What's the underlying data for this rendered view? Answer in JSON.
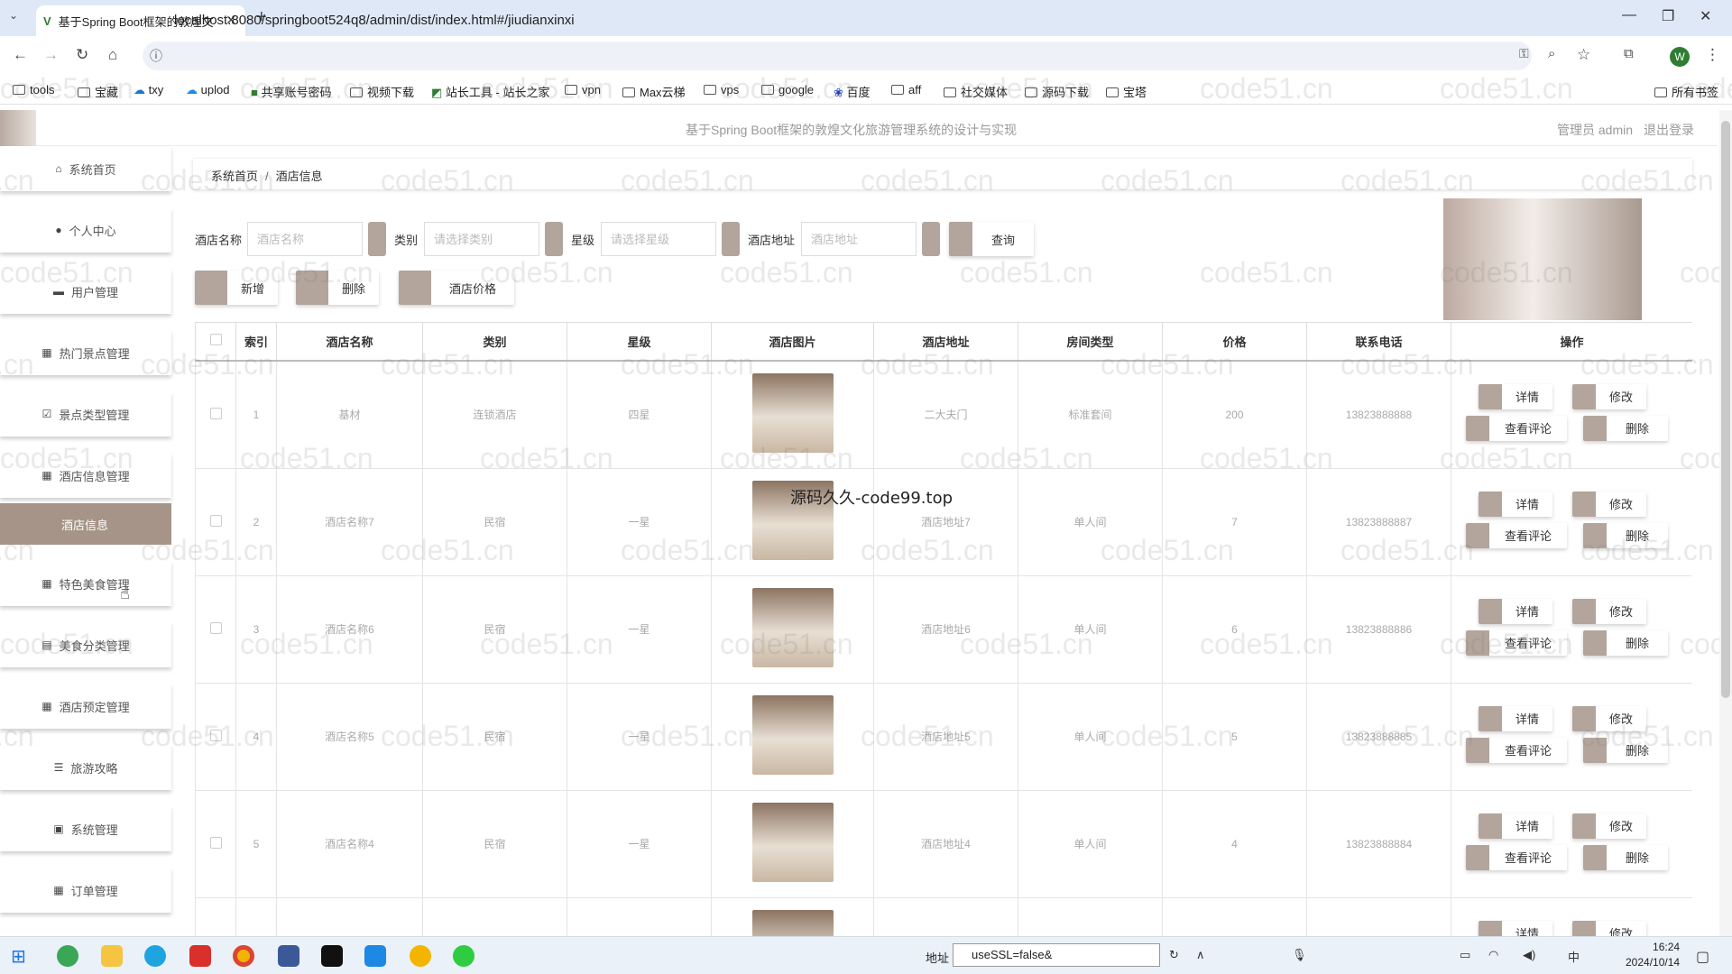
{
  "browser": {
    "tab_title": "基于Spring Boot框架的敦煌文",
    "tab_favicon": "V",
    "url": "localhost:8080/springboot524q8/admin/dist/index.html#/jiudianxinxi",
    "profile_initial": "W",
    "bookmarks": [
      "tools",
      "宝藏",
      "txy",
      "uplod",
      "共享账号密码",
      "视频下载",
      "站长工具 - 站长之家",
      "vpn",
      "Max云梯",
      "vps",
      "google",
      "百度",
      "aff",
      "社交媒体",
      "源码下载",
      "宝塔"
    ],
    "all_bookmarks": "所有书签"
  },
  "header": {
    "title": "基于Spring Boot框架的敦煌文化旅游管理系统的设计与实现",
    "user": "管理员 admin",
    "logout": "退出登录"
  },
  "sidebar": {
    "items": [
      {
        "label": "系统首页",
        "icon": "home-icon"
      },
      {
        "label": "个人中心",
        "icon": "user-icon"
      },
      {
        "label": "用户管理",
        "icon": "users-icon"
      },
      {
        "label": "热门景点管理",
        "icon": "grid-icon"
      },
      {
        "label": "景点类型管理",
        "icon": "check-square-icon"
      },
      {
        "label": "酒店信息管理",
        "icon": "grid-icon"
      },
      {
        "label": "酒店信息",
        "icon": "",
        "active": true
      },
      {
        "label": "特色美食管理",
        "icon": "grid-icon"
      },
      {
        "label": "美食分类管理",
        "icon": "clipboard-icon"
      },
      {
        "label": "酒店预定管理",
        "icon": "grid-icon"
      },
      {
        "label": "旅游攻略",
        "icon": "list-icon"
      },
      {
        "label": "系统管理",
        "icon": "clipboard-check-icon"
      },
      {
        "label": "订单管理",
        "icon": "grid-icon"
      }
    ]
  },
  "breadcrumb": {
    "home": "系统首页",
    "current": "酒店信息"
  },
  "search": {
    "name_label": "酒店名称",
    "name_placeholder": "酒店名称",
    "type_label": "类别",
    "type_placeholder": "请选择类别",
    "star_label": "星级",
    "star_placeholder": "请选择星级",
    "addr_label": "酒店地址",
    "addr_placeholder": "酒店地址",
    "query": "查询"
  },
  "actions": {
    "add": "新增",
    "delete": "删除",
    "price": "酒店价格"
  },
  "table": {
    "headers": [
      "",
      "索引",
      "酒店名称",
      "类别",
      "星级",
      "酒店图片",
      "酒店地址",
      "房间类型",
      "价格",
      "联系电话",
      "操作"
    ],
    "rows": [
      {
        "index": "1",
        "name": "基材",
        "type": "连锁酒店",
        "star": "四星",
        "addr": "二大夫门",
        "room": "标准套间",
        "price": "200",
        "phone": "13823888888"
      },
      {
        "index": "2",
        "name": "酒店名称7",
        "type": "民宿",
        "star": "一星",
        "addr": "酒店地址7",
        "room": "单人间",
        "price": "7",
        "phone": "13823888887"
      },
      {
        "index": "3",
        "name": "酒店名称6",
        "type": "民宿",
        "star": "一星",
        "addr": "酒店地址6",
        "room": "单人间",
        "price": "6",
        "phone": "13823888886"
      },
      {
        "index": "4",
        "name": "酒店名称5",
        "type": "民宿",
        "star": "一星",
        "addr": "酒店地址5",
        "room": "单人间",
        "price": "5",
        "phone": "13823888885"
      },
      {
        "index": "5",
        "name": "酒店名称4",
        "type": "民宿",
        "star": "一星",
        "addr": "酒店地址4",
        "room": "单人间",
        "price": "4",
        "phone": "13823888884"
      },
      {
        "index": "",
        "name": "",
        "type": "",
        "star": "",
        "addr": "",
        "room": "",
        "price": "",
        "phone": ""
      }
    ],
    "ops": {
      "detail": "详情",
      "edit": "修改",
      "comments": "查看评论",
      "delete": "删除"
    }
  },
  "watermark": "code51.cn",
  "watermark2": "源码久久-code99.top",
  "taskbar": {
    "addr_label": "地址",
    "addr_value": "useSSL=false&",
    "time": "16:24",
    "date": "2024/10/14",
    "ime": "中"
  }
}
